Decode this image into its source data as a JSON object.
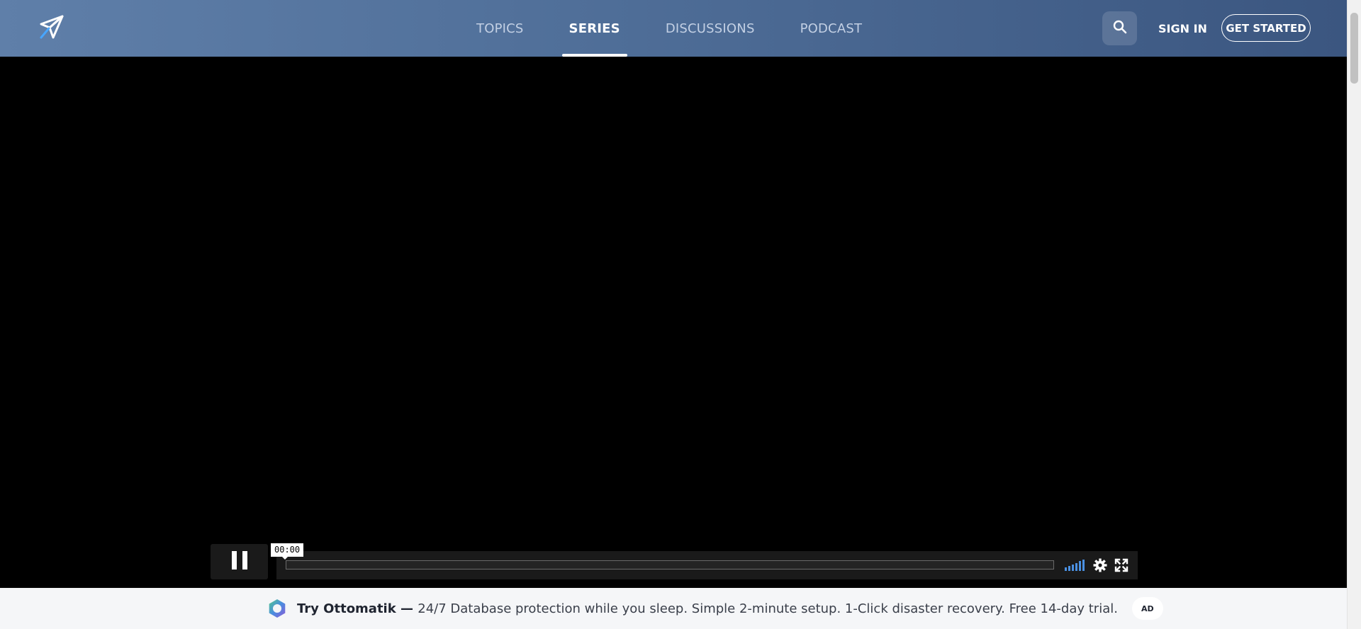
{
  "header": {
    "logo_icon": "paper-plane-icon",
    "nav": [
      {
        "label": "TOPICS",
        "active": false
      },
      {
        "label": "SERIES",
        "active": true
      },
      {
        "label": "DISCUSSIONS",
        "active": false
      },
      {
        "label": "PODCAST",
        "active": false
      }
    ],
    "search_icon": "search-icon",
    "sign_in_label": "SIGN IN",
    "get_started_label": "GET STARTED"
  },
  "player": {
    "current_time": "00:00",
    "progress": 0,
    "pause_icon": "pause-icon",
    "volume_icon": "volume-bars-icon",
    "settings_icon": "gear-icon",
    "fullscreen_icon": "fullscreen-icon"
  },
  "ad": {
    "logo_icon": "ottomatik-logo-icon",
    "title": "Try Ottomatik — ",
    "text": "24/7 Database protection while you sleep. Simple 2-minute setup. 1-Click disaster recovery. Free 14-day trial.",
    "badge": "AD"
  },
  "colors": {
    "header_start": "#5f7fa9",
    "header_end": "#3b5680",
    "video_bg": "#000000",
    "volume_accent": "#4a90e2",
    "ad_bg": "#f5f6f8"
  }
}
